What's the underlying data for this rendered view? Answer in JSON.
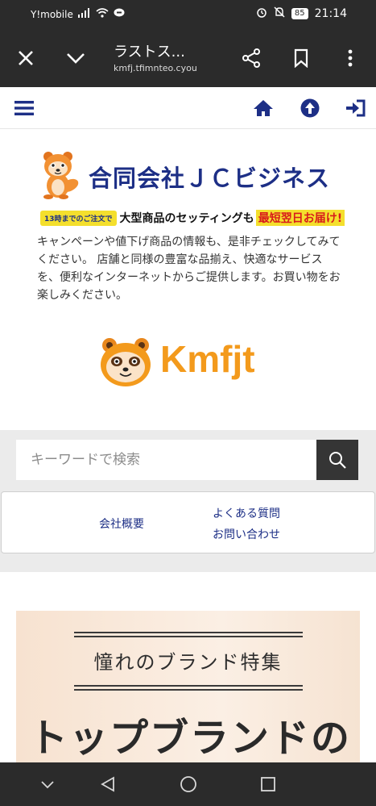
{
  "status_bar": {
    "carrier": "Y!mobile",
    "battery": "85",
    "time": "21:14"
  },
  "browser": {
    "tab_title": "ラストス...",
    "url": "kmfj.tfimnteo.cyou"
  },
  "site": {
    "company_name": "合同会社ＪＣビジネス",
    "promo_tag": "13時までのご注文で",
    "promo_main": "大型商品のセッティングも",
    "promo_highlight": "最短翌日お届け!",
    "intro": "キャンペーンや値下げ商品の情報も、是非チェックしてみてください。 店舗と同様の豊富な品揃え、快適なサービスを、便利なインターネットからご提供します。お買い物をお楽しみください。",
    "brand_logo_text": "Kmfjt",
    "search_placeholder": "キーワードで検索",
    "links": {
      "company_overview": "会社概要",
      "faq": "よくある質問",
      "contact": "お問い合わせ"
    },
    "banner": {
      "subtitle": "憧れのブランド特集",
      "headline": "トップブランドの"
    }
  },
  "colors": {
    "navy": "#1d2f86",
    "orange": "#f39a1c",
    "dark_chrome": "#2b2b2b"
  }
}
